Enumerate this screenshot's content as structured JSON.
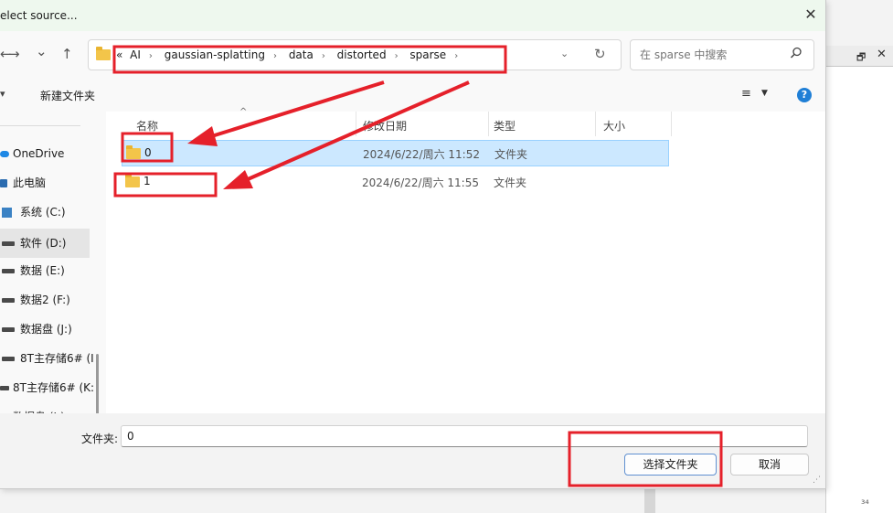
{
  "dialog": {
    "title": "elect source...",
    "close_glyph": "✕"
  },
  "nav": {
    "back_glyph": "←",
    "forward_glyph": "→",
    "history_glyph": "⌄",
    "up_glyph": "↑"
  },
  "address": {
    "overflow": "«",
    "crumbs": [
      "AI",
      "gaussian-splatting",
      "data",
      "distorted",
      "sparse"
    ],
    "separator": "›",
    "dropdown_glyph": "⌄",
    "refresh_glyph": "↻"
  },
  "search": {
    "placeholder": "在 sparse 中搜索",
    "icon": "search-icon"
  },
  "toolbar": {
    "left_glyph": "▾",
    "new_folder": "新建文件夹",
    "view_glyph": "≡",
    "view_dropdown_glyph": "▼",
    "help_glyph": "?"
  },
  "sidebar": {
    "items": [
      {
        "label": "OneDrive",
        "icon": "onedrive-icon"
      },
      {
        "label": "此电脑",
        "icon": "this-pc-icon"
      },
      {
        "label": "系统 (C:)",
        "icon": "windows-drive-icon"
      },
      {
        "label": "软件 (D:)",
        "icon": "drive-icon",
        "selected": true
      },
      {
        "label": "数据 (E:)",
        "icon": "drive-icon"
      },
      {
        "label": "数据2 (F:)",
        "icon": "drive-icon"
      },
      {
        "label": "数据盘 (J:)",
        "icon": "drive-icon"
      },
      {
        "label": "8T主存储6# (I",
        "icon": "drive-icon"
      },
      {
        "label": "8T主存储6# (K:",
        "icon": "drive-icon"
      },
      {
        "label": "数据盘 (J:)",
        "icon": "drive-icon"
      }
    ]
  },
  "files": {
    "columns": [
      "名称",
      "修改日期",
      "类型",
      "大小"
    ],
    "sort_glyph": "^",
    "rows": [
      {
        "name": "0",
        "modified": "2024/6/22/周六 11:52",
        "type": "文件夹",
        "size": "",
        "selected": true
      },
      {
        "name": "1",
        "modified": "2024/6/22/周六 11:55",
        "type": "文件夹",
        "size": "",
        "selected": false
      }
    ]
  },
  "footer": {
    "folder_label": "文件夹:",
    "folder_value": "0",
    "select_button": "选择文件夹",
    "cancel_button": "取消"
  },
  "background_window": {
    "restore_glyph": "🗗",
    "close_glyph": "✕",
    "corner_text": "₃₄"
  },
  "annotations": {
    "color": "#e5202a"
  }
}
